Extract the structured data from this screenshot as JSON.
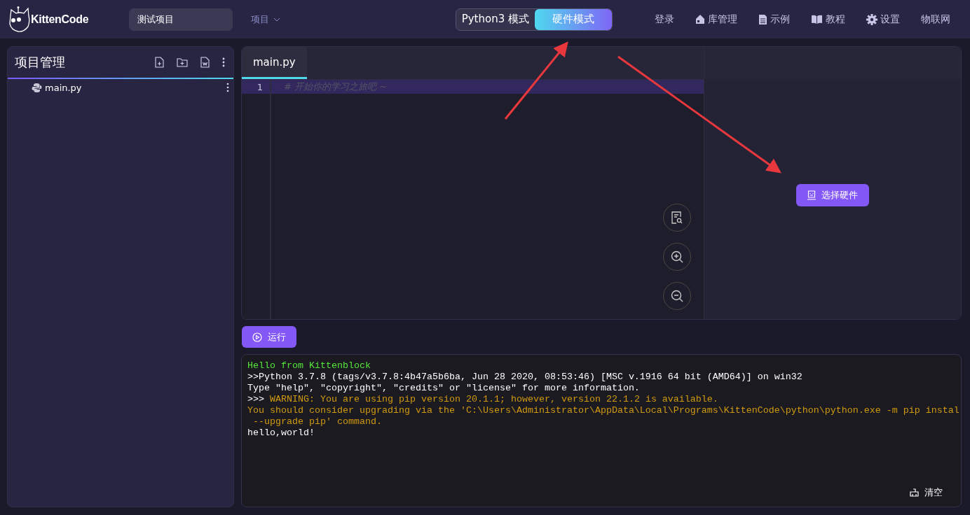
{
  "header": {
    "logo": "KittenCode",
    "project_name": "测试项目",
    "project_menu": "项目",
    "modes": [
      {
        "label": "Python3 模式",
        "selected": false
      },
      {
        "label": "硬件模式",
        "selected": true
      }
    ],
    "nav": [
      {
        "label": "登录"
      },
      {
        "label": "库管理"
      },
      {
        "label": "示例"
      },
      {
        "label": "教程"
      },
      {
        "label": "设置"
      },
      {
        "label": "物联网"
      }
    ]
  },
  "sidebar": {
    "title": "项目管理",
    "files": [
      {
        "name": "main.py"
      }
    ]
  },
  "editor": {
    "tabs": [
      {
        "label": "main.py",
        "selected": true
      }
    ],
    "lines": [
      {
        "number": "1",
        "text": "# 开始你的学习之旅吧 ~",
        "current": true
      }
    ],
    "select_hardware": "选择硬件"
  },
  "run_button": "运行",
  "console": {
    "lines": [
      {
        "kind": "info",
        "text": "Hello from Kittenblock"
      },
      {
        "kind": "output",
        "text": ">>Python 3.7.8 (tags/v3.7.8:4b47a5b6ba, Jun 28 2020, 08:53:46) [MSC v.1916 64 bit (AMD64)] on win32"
      },
      {
        "kind": "output",
        "text": "Type \"help\", \"copyright\", \"credits\" or \"license\" for more information."
      },
      {
        "kind": "warning",
        "prompt": ">>> ",
        "text": "WARNING: You are using pip version 20.1.1; however, version 22.1.2 is available."
      },
      {
        "kind": "warning",
        "text": "You should consider upgrading via the 'C:\\Users\\Administrator\\AppData\\Local\\Programs\\KittenCode\\python\\python.exe -m pip instal"
      },
      {
        "kind": "warning",
        "text": " --upgrade pip' command."
      },
      {
        "kind": "output",
        "text": "hello,world!"
      }
    ],
    "clear": "清空"
  }
}
